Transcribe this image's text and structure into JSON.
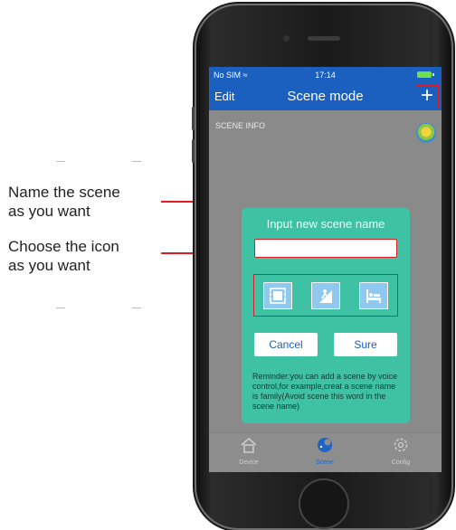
{
  "annotations": [
    {
      "line1": "Name the scene",
      "line2": "as you want"
    },
    {
      "line1": "Choose the icon",
      "line2": "as you want"
    }
  ],
  "status_bar": {
    "carrier": "No SIM ≈",
    "time": "17:14"
  },
  "nav": {
    "edit_label": "Edit",
    "title": "Scene mode",
    "add_label": "+"
  },
  "content": {
    "section_label": "SCENE INFO"
  },
  "dialog": {
    "title": "Input new scene name",
    "input_value": "",
    "icons": [
      "film-scene-icon",
      "climbing-scene-icon",
      "sleep-scene-icon"
    ],
    "cancel_label": "Cancel",
    "sure_label": "Sure",
    "reminder": "Reminder:you can add a scene by voice control,for example,creat a scene name is family(Avoid scene this word in the scene name)"
  },
  "tabbar": {
    "tabs": [
      {
        "label": "Device",
        "icon": "house-icon",
        "active": false
      },
      {
        "label": "Scene",
        "icon": "scene-icon",
        "active": true
      },
      {
        "label": "Config",
        "icon": "gear-icon",
        "active": false
      }
    ]
  },
  "colors": {
    "nav_blue": "#1b5fbf",
    "dialog_green": "#3fc2a3",
    "highlight_red": "#e01b22",
    "overlay_gray": "#8a8a8a"
  }
}
